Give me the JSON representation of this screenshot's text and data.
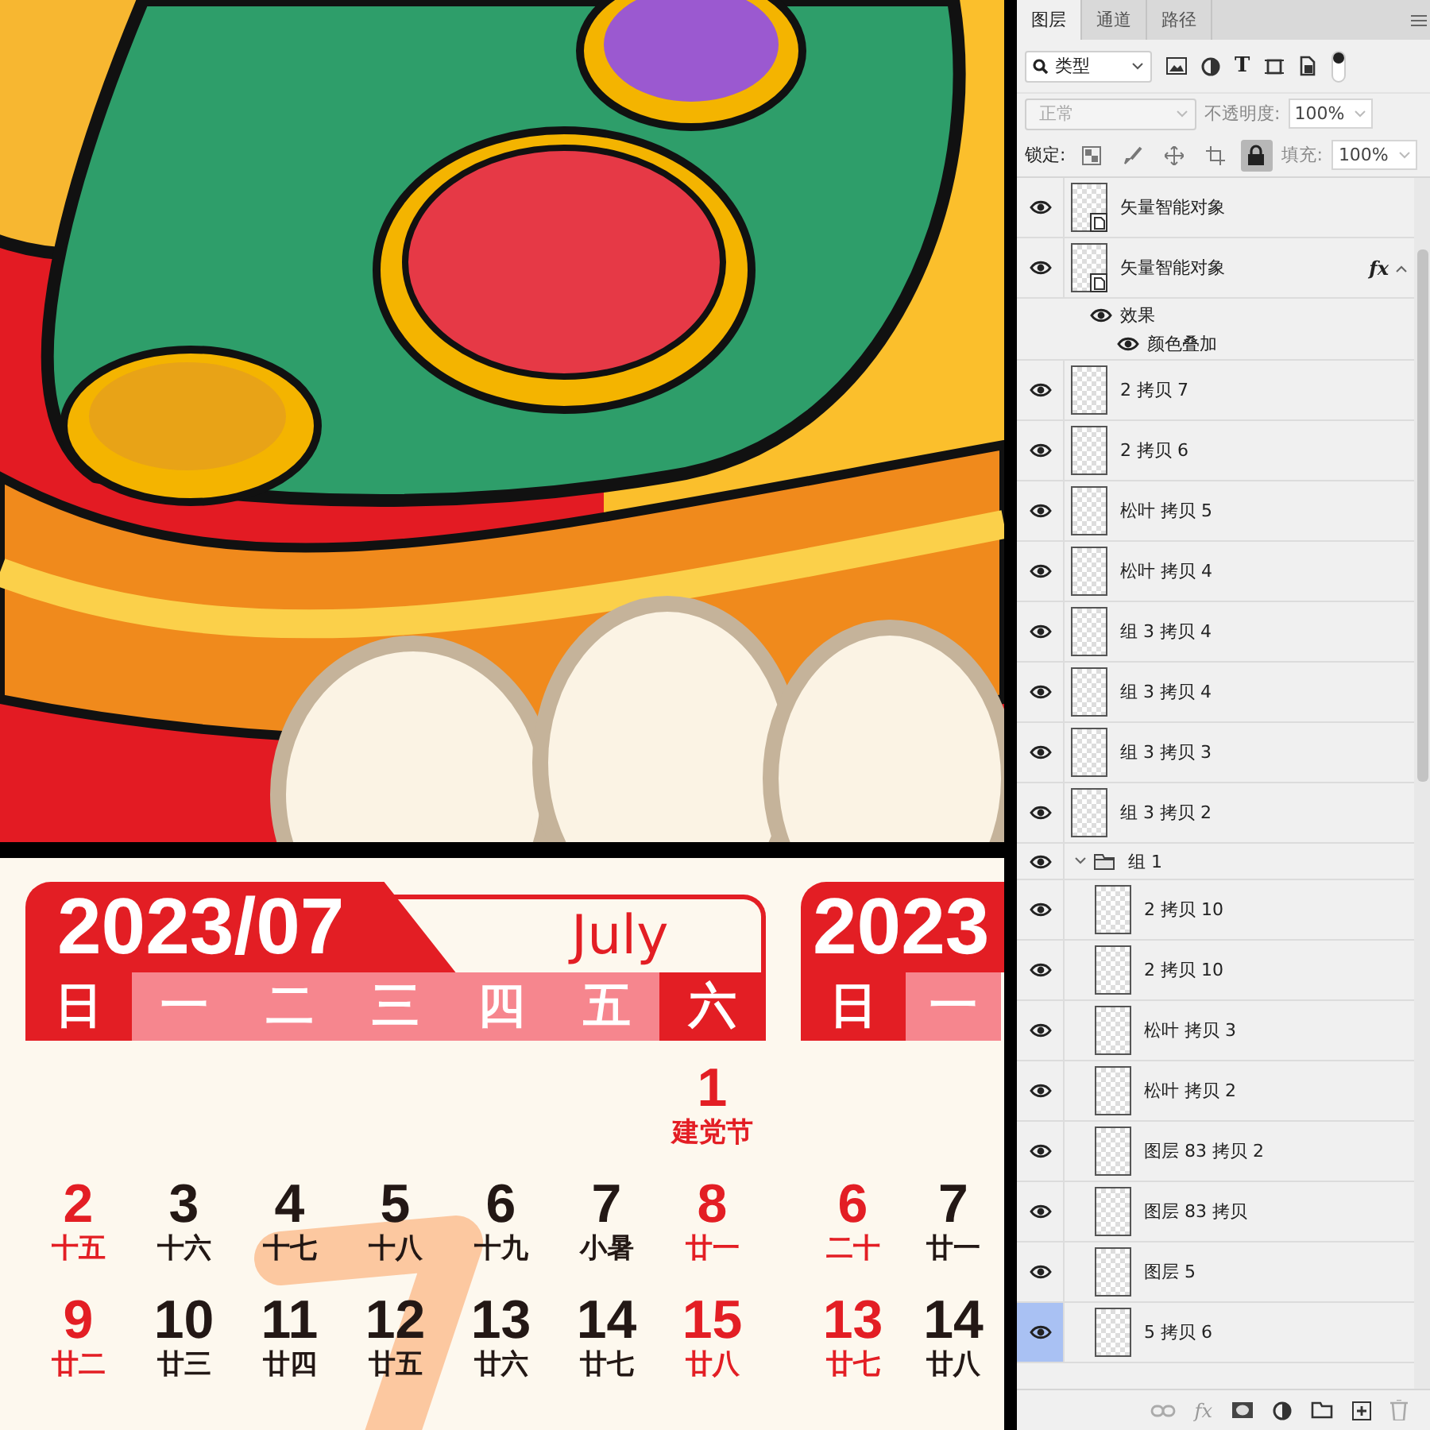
{
  "canvas": {
    "calendars": [
      {
        "title": "2023/07",
        "month_name": "July",
        "weekdays": [
          {
            "label": "日",
            "kind": "weekend"
          },
          {
            "label": "一",
            "kind": "weekday"
          },
          {
            "label": "二",
            "kind": "weekday"
          },
          {
            "label": "三",
            "kind": "weekday"
          },
          {
            "label": "四",
            "kind": "weekday"
          },
          {
            "label": "五",
            "kind": "weekday"
          },
          {
            "label": "六",
            "kind": "weekend"
          }
        ],
        "weeks": [
          [
            {
              "day": "1",
              "note": "建党节"
            }
          ],
          [
            {
              "day": "2",
              "note": "十五"
            },
            {
              "day": "3",
              "note": "十六"
            },
            {
              "day": "4",
              "note": "十七"
            },
            {
              "day": "5",
              "note": "十八"
            },
            {
              "day": "6",
              "note": "十九"
            },
            {
              "day": "7",
              "note": "小暑"
            },
            {
              "day": "8",
              "note": "廿一"
            }
          ],
          [
            {
              "day": "9",
              "note": "廿二"
            },
            {
              "day": "10",
              "note": "廿三"
            },
            {
              "day": "11",
              "note": "廿四"
            },
            {
              "day": "12",
              "note": "廿五"
            },
            {
              "day": "13",
              "note": "廿六"
            },
            {
              "day": "14",
              "note": "廿七"
            },
            {
              "day": "15",
              "note": "廿八"
            }
          ]
        ]
      },
      {
        "title": "2023",
        "weekdays": [
          {
            "label": "日",
            "kind": "weekend"
          },
          {
            "label": "一",
            "kind": "weekday"
          }
        ],
        "weeks": [
          [
            {
              "day": "6",
              "note": "二十"
            },
            {
              "day": "7",
              "note": "廿一"
            }
          ],
          [
            {
              "day": "13",
              "note": "廿七"
            },
            {
              "day": "14",
              "note": "廿八"
            }
          ]
        ]
      }
    ]
  },
  "panel": {
    "tabs": [
      {
        "label": "图层",
        "selected": true
      },
      {
        "label": "通道",
        "selected": false
      },
      {
        "label": "路径",
        "selected": false
      }
    ],
    "filter": {
      "value": "类型",
      "type_icon": "T"
    },
    "blend": {
      "mode": "正常",
      "disabled": true,
      "opacity_label": "不透明度:",
      "opacity": "100%"
    },
    "lock": {
      "label": "锁定:",
      "locks": [
        {
          "kind": "pixels",
          "selected": false
        },
        {
          "kind": "paint",
          "selected": false
        },
        {
          "kind": "move",
          "selected": false
        },
        {
          "kind": "artboard",
          "selected": false
        },
        {
          "kind": "all",
          "selected": true
        }
      ],
      "fill_label": "填充:",
      "fill": "100%"
    },
    "layers": [
      {
        "kind": "smart",
        "name": "矢量智能对象",
        "visible": true,
        "selected": false
      },
      {
        "kind": "smart",
        "name": "矢量智能对象",
        "visible": true,
        "selected": false,
        "fx": "fx",
        "expanded": true,
        "effects": {
          "label": "效果",
          "visible": true,
          "items": [
            {
              "name": "颜色叠加",
              "visible": true
            }
          ]
        }
      },
      {
        "kind": "pixel",
        "name": "2 拷贝 7",
        "visible": true,
        "selected": false
      },
      {
        "kind": "pixel",
        "name": "2 拷贝 6",
        "visible": true,
        "selected": false
      },
      {
        "kind": "pixel",
        "name": "松叶 拷贝 5",
        "visible": true,
        "selected": false
      },
      {
        "kind": "pixel",
        "name": "松叶 拷贝 4",
        "visible": true,
        "selected": false
      },
      {
        "kind": "pixel",
        "name": "组 3 拷贝 4",
        "visible": true,
        "selected": false
      },
      {
        "kind": "pixel",
        "name": "组 3 拷贝 4",
        "visible": true,
        "selected": false
      },
      {
        "kind": "pixel",
        "name": "组 3 拷贝 3",
        "visible": true,
        "selected": false
      },
      {
        "kind": "pixel",
        "name": "组 3 拷贝 2",
        "visible": true,
        "selected": false
      },
      {
        "kind": "group",
        "name": "组 1",
        "visible": true,
        "selected": false,
        "expanded": true,
        "children": [
          {
            "kind": "pixel",
            "name": "2 拷贝 10",
            "visible": true,
            "selected": false
          },
          {
            "kind": "pixel",
            "name": "2 拷贝 10",
            "visible": true,
            "selected": false
          },
          {
            "kind": "pixel",
            "name": "松叶 拷贝 3",
            "visible": true,
            "selected": false
          },
          {
            "kind": "pixel",
            "name": "松叶 拷贝 2",
            "visible": true,
            "selected": false
          },
          {
            "kind": "pixel",
            "name": "图层 83 拷贝 2",
            "visible": true,
            "selected": false
          },
          {
            "kind": "pixel",
            "name": "图层 83 拷贝",
            "visible": true,
            "selected": false
          },
          {
            "kind": "pixel",
            "name": "图层 5",
            "visible": true,
            "selected": false
          },
          {
            "kind": "pixel",
            "name": "5 拷贝 6",
            "visible": true,
            "selected": true
          }
        ]
      }
    ],
    "footer": {
      "fx": "fx"
    }
  }
}
